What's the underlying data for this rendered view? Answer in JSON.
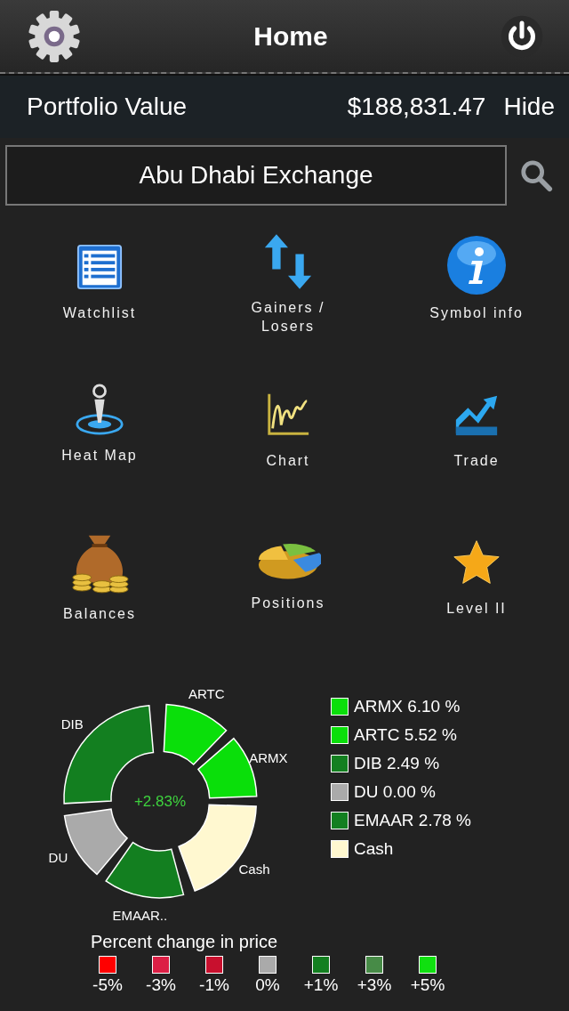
{
  "header": {
    "title": "Home"
  },
  "portfolio": {
    "label": "Portfolio Value",
    "value": "$188,831.47",
    "toggle": "Hide"
  },
  "exchange": {
    "value": "Abu Dhabi Exchange"
  },
  "menu": [
    {
      "label": "Watchlist"
    },
    {
      "label": "Gainers /\nLosers"
    },
    {
      "label": "Symbol info"
    },
    {
      "label": "Heat Map"
    },
    {
      "label": "Chart"
    },
    {
      "label": "Trade"
    },
    {
      "label": "Balances"
    },
    {
      "label": "Positions"
    },
    {
      "label": "Level II"
    }
  ],
  "allocation": {
    "center": "+2.83%",
    "slices": [
      {
        "label": "ARTC",
        "color": "#0adf0a"
      },
      {
        "label": "ARMX",
        "color": "#0adf0a"
      },
      {
        "label": "Cash",
        "color": "#fff8d0"
      },
      {
        "label": "EMAAR..",
        "color": "#137f20"
      },
      {
        "label": "DU",
        "color": "#aaaaaa"
      },
      {
        "label": "DIB",
        "color": "#137f20"
      }
    ],
    "legend": [
      {
        "label": "ARMX 6.10 %",
        "color": "#0adf0a"
      },
      {
        "label": "ARTC 5.52 %",
        "color": "#0adf0a"
      },
      {
        "label": "DIB 2.49 %",
        "color": "#137f20"
      },
      {
        "label": "DU 0.00 %",
        "color": "#aaaaaa"
      },
      {
        "label": "EMAAR 2.78 %",
        "color": "#137f20"
      },
      {
        "label": "Cash",
        "color": "#fff8d0"
      }
    ]
  },
  "scale": {
    "title": "Percent change in price",
    "steps": [
      {
        "label": "-5%",
        "color": "#ff0000"
      },
      {
        "label": "-3%",
        "color": "#dc1f45"
      },
      {
        "label": "-1%",
        "color": "#c8102e"
      },
      {
        "label": "0%",
        "color": "#aaaaaa"
      },
      {
        "label": "+1%",
        "color": "#137f20"
      },
      {
        "label": "+3%",
        "color": "#478b47"
      },
      {
        "label": "+5%",
        "color": "#10e010"
      }
    ]
  }
}
